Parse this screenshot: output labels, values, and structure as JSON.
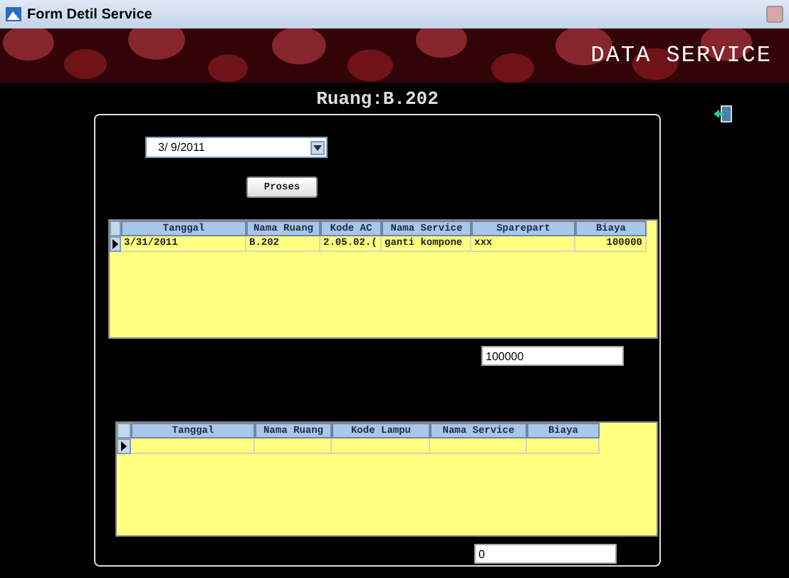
{
  "window": {
    "title": "Form Detil Service"
  },
  "banner": {
    "title": "DATA SERVICE"
  },
  "room_label": "Ruang:B.202",
  "date_picker": {
    "value": "3/ 9/2011"
  },
  "process_button": "Proses",
  "service_grid": {
    "columns": [
      "Tanggal",
      "Nama Ruang",
      "Kode AC",
      "Nama Service",
      "Sparepart",
      "Biaya"
    ],
    "rows": [
      {
        "current": true,
        "cells": [
          "3/31/2011",
          "B.202",
          "2.05.02.(",
          "ganti kompone",
          "xxx",
          "100000"
        ]
      }
    ]
  },
  "service_total": {
    "value": "100000"
  },
  "lamp_grid": {
    "columns": [
      "Tanggal",
      "Nama Ruang",
      "Kode Lampu",
      "Nama Service",
      "Biaya"
    ],
    "rows": [
      {
        "current": true
      }
    ]
  },
  "lamp_total": {
    "value": "0"
  }
}
